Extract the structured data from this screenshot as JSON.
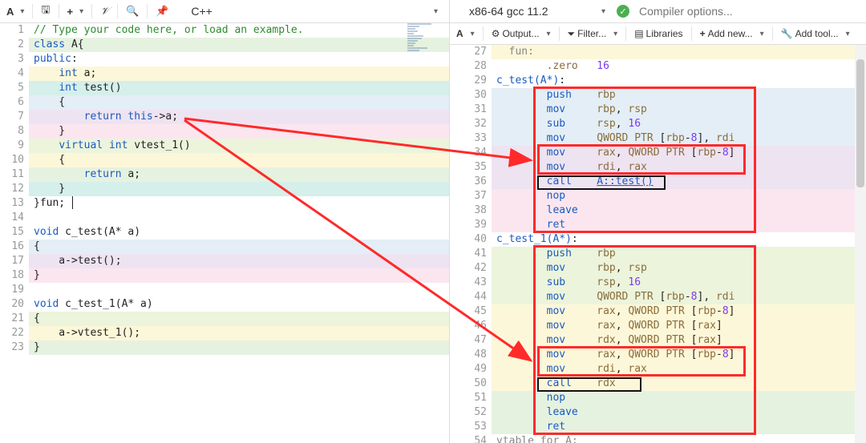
{
  "left": {
    "lang": "C++",
    "code": [
      {
        "n": 1,
        "bg": "",
        "html": "<span class='tk-comment'>// Type your code here, or load an example.</span>"
      },
      {
        "n": 2,
        "bg": "bg-green",
        "html": "<span class='tk-kw'>class</span> A{"
      },
      {
        "n": 3,
        "bg": "",
        "html": "<span class='tk-kw'>public</span>:"
      },
      {
        "n": 4,
        "bg": "bg-yellow",
        "html": "    <span class='tk-kw'>int</span> a;"
      },
      {
        "n": 5,
        "bg": "bg-teal",
        "html": "    <span class='tk-kw'>int</span> test()"
      },
      {
        "n": 6,
        "bg": "bg-blue",
        "html": "    {"
      },
      {
        "n": 7,
        "bg": "bg-purple",
        "html": "        <span class='tk-kw'>return</span> <span class='tk-kw'>this</span>-&gt;a;"
      },
      {
        "n": 8,
        "bg": "bg-pink",
        "html": "    }"
      },
      {
        "n": 9,
        "bg": "bg-lgreen",
        "html": "    <span class='tk-kw'>virtual</span> <span class='tk-kw'>int</span> vtest_1()"
      },
      {
        "n": 10,
        "bg": "bg-yellow",
        "html": "    {"
      },
      {
        "n": 11,
        "bg": "bg-green",
        "html": "        <span class='tk-kw'>return</span> a;"
      },
      {
        "n": 12,
        "bg": "bg-teal",
        "html": "    }"
      },
      {
        "n": 13,
        "bg": "",
        "html": "}fun;"
      },
      {
        "n": 14,
        "bg": "",
        "html": ""
      },
      {
        "n": 15,
        "bg": "",
        "html": "<span class='tk-kw'>void</span> c_test(A* a)"
      },
      {
        "n": 16,
        "bg": "bg-blue",
        "html": "{"
      },
      {
        "n": 17,
        "bg": "bg-purple",
        "html": "    a-&gt;test();"
      },
      {
        "n": 18,
        "bg": "bg-pink",
        "html": "}"
      },
      {
        "n": 19,
        "bg": "",
        "html": ""
      },
      {
        "n": 20,
        "bg": "",
        "html": "<span class='tk-kw'>void</span> c_test_1(A* a)"
      },
      {
        "n": 21,
        "bg": "bg-lgreen",
        "html": "{"
      },
      {
        "n": 22,
        "bg": "bg-yellow",
        "html": "    a-&gt;vtest_1();"
      },
      {
        "n": 23,
        "bg": "bg-green",
        "html": "}"
      }
    ]
  },
  "right": {
    "compiler": "x86-64 gcc 11.2",
    "compiler_opts_placeholder": "Compiler options...",
    "toolbar": {
      "output": "Output...",
      "filter": "Filter...",
      "libraries": "Libraries",
      "addnew": "Add new...",
      "addtool": "Add tool..."
    },
    "asm": [
      {
        "n": 27,
        "bg": "bg-yellow",
        "html": "  <span class='tk-gray'>fun:</span>"
      },
      {
        "n": 28,
        "bg": "",
        "html": "        <span class='tk-asm-dir'>.zero</span>   <span class='tk-num'>16</span>"
      },
      {
        "n": 29,
        "bg": "",
        "html": "<span class='tk-asm-lbl'>c_test(A*)</span>:"
      },
      {
        "n": 30,
        "bg": "bg-blue",
        "html": "        <span class='tk-asm-op'>push</span>    <span class='tk-asm-reg'>rbp</span>"
      },
      {
        "n": 31,
        "bg": "bg-blue",
        "html": "        <span class='tk-asm-op'>mov</span>     <span class='tk-asm-reg'>rbp</span>, <span class='tk-asm-reg'>rsp</span>"
      },
      {
        "n": 32,
        "bg": "bg-blue",
        "html": "        <span class='tk-asm-op'>sub</span>     <span class='tk-asm-reg'>rsp</span>, <span class='tk-num'>16</span>"
      },
      {
        "n": 33,
        "bg": "bg-blue",
        "html": "        <span class='tk-asm-op'>mov</span>     <span class='tk-asm-reg'>QWORD PTR</span> [<span class='tk-asm-reg'>rbp</span>-<span class='tk-num'>8</span>], <span class='tk-asm-reg'>rdi</span>"
      },
      {
        "n": 34,
        "bg": "bg-purple",
        "html": "        <span class='tk-asm-op'>mov</span>     <span class='tk-asm-reg'>rax</span>, <span class='tk-asm-reg'>QWORD PTR</span> [<span class='tk-asm-reg'>rbp</span>-<span class='tk-num'>8</span>]"
      },
      {
        "n": 35,
        "bg": "bg-purple",
        "html": "        <span class='tk-asm-op'>mov</span>     <span class='tk-asm-reg'>rdi</span>, <span class='tk-asm-reg'>rax</span>"
      },
      {
        "n": 36,
        "bg": "bg-purple",
        "html": "        <span class='tk-asm-op'>call</span>    <span class='tk-link'>A::test()</span>"
      },
      {
        "n": 37,
        "bg": "bg-pink",
        "html": "        <span class='tk-asm-op'>nop</span>"
      },
      {
        "n": 38,
        "bg": "bg-pink",
        "html": "        <span class='tk-asm-op'>leave</span>"
      },
      {
        "n": 39,
        "bg": "bg-pink",
        "html": "        <span class='tk-asm-op'>ret</span>"
      },
      {
        "n": 40,
        "bg": "",
        "html": "<span class='tk-asm-lbl'>c_test_1(A*)</span>:"
      },
      {
        "n": 41,
        "bg": "bg-lgreen",
        "html": "        <span class='tk-asm-op'>push</span>    <span class='tk-asm-reg'>rbp</span>"
      },
      {
        "n": 42,
        "bg": "bg-lgreen",
        "html": "        <span class='tk-asm-op'>mov</span>     <span class='tk-asm-reg'>rbp</span>, <span class='tk-asm-reg'>rsp</span>"
      },
      {
        "n": 43,
        "bg": "bg-lgreen",
        "html": "        <span class='tk-asm-op'>sub</span>     <span class='tk-asm-reg'>rsp</span>, <span class='tk-num'>16</span>"
      },
      {
        "n": 44,
        "bg": "bg-lgreen",
        "html": "        <span class='tk-asm-op'>mov</span>     <span class='tk-asm-reg'>QWORD PTR</span> [<span class='tk-asm-reg'>rbp</span>-<span class='tk-num'>8</span>], <span class='tk-asm-reg'>rdi</span>"
      },
      {
        "n": 45,
        "bg": "bg-yellow",
        "html": "        <span class='tk-asm-op'>mov</span>     <span class='tk-asm-reg'>rax</span>, <span class='tk-asm-reg'>QWORD PTR</span> [<span class='tk-asm-reg'>rbp</span>-<span class='tk-num'>8</span>]"
      },
      {
        "n": 46,
        "bg": "bg-yellow",
        "html": "        <span class='tk-asm-op'>mov</span>     <span class='tk-asm-reg'>rax</span>, <span class='tk-asm-reg'>QWORD PTR</span> [<span class='tk-asm-reg'>rax</span>]"
      },
      {
        "n": 47,
        "bg": "bg-yellow",
        "html": "        <span class='tk-asm-op'>mov</span>     <span class='tk-asm-reg'>rdx</span>, <span class='tk-asm-reg'>QWORD PTR</span> [<span class='tk-asm-reg'>rax</span>]"
      },
      {
        "n": 48,
        "bg": "bg-yellow",
        "html": "        <span class='tk-asm-op'>mov</span>     <span class='tk-asm-reg'>rax</span>, <span class='tk-asm-reg'>QWORD PTR</span> [<span class='tk-asm-reg'>rbp</span>-<span class='tk-num'>8</span>]"
      },
      {
        "n": 49,
        "bg": "bg-yellow",
        "html": "        <span class='tk-asm-op'>mov</span>     <span class='tk-asm-reg'>rdi</span>, <span class='tk-asm-reg'>rax</span>"
      },
      {
        "n": 50,
        "bg": "bg-yellow",
        "html": "        <span class='tk-asm-op'>call</span>    <span class='tk-asm-reg'>rdx</span>"
      },
      {
        "n": 51,
        "bg": "bg-green",
        "html": "        <span class='tk-asm-op'>nop</span>"
      },
      {
        "n": 52,
        "bg": "bg-green",
        "html": "        <span class='tk-asm-op'>leave</span>"
      },
      {
        "n": 53,
        "bg": "bg-green",
        "html": "        <span class='tk-asm-op'>ret</span>"
      },
      {
        "n": 54,
        "bg": "",
        "html": "<span class='tk-gray'>vtable for A:</span>"
      }
    ]
  }
}
